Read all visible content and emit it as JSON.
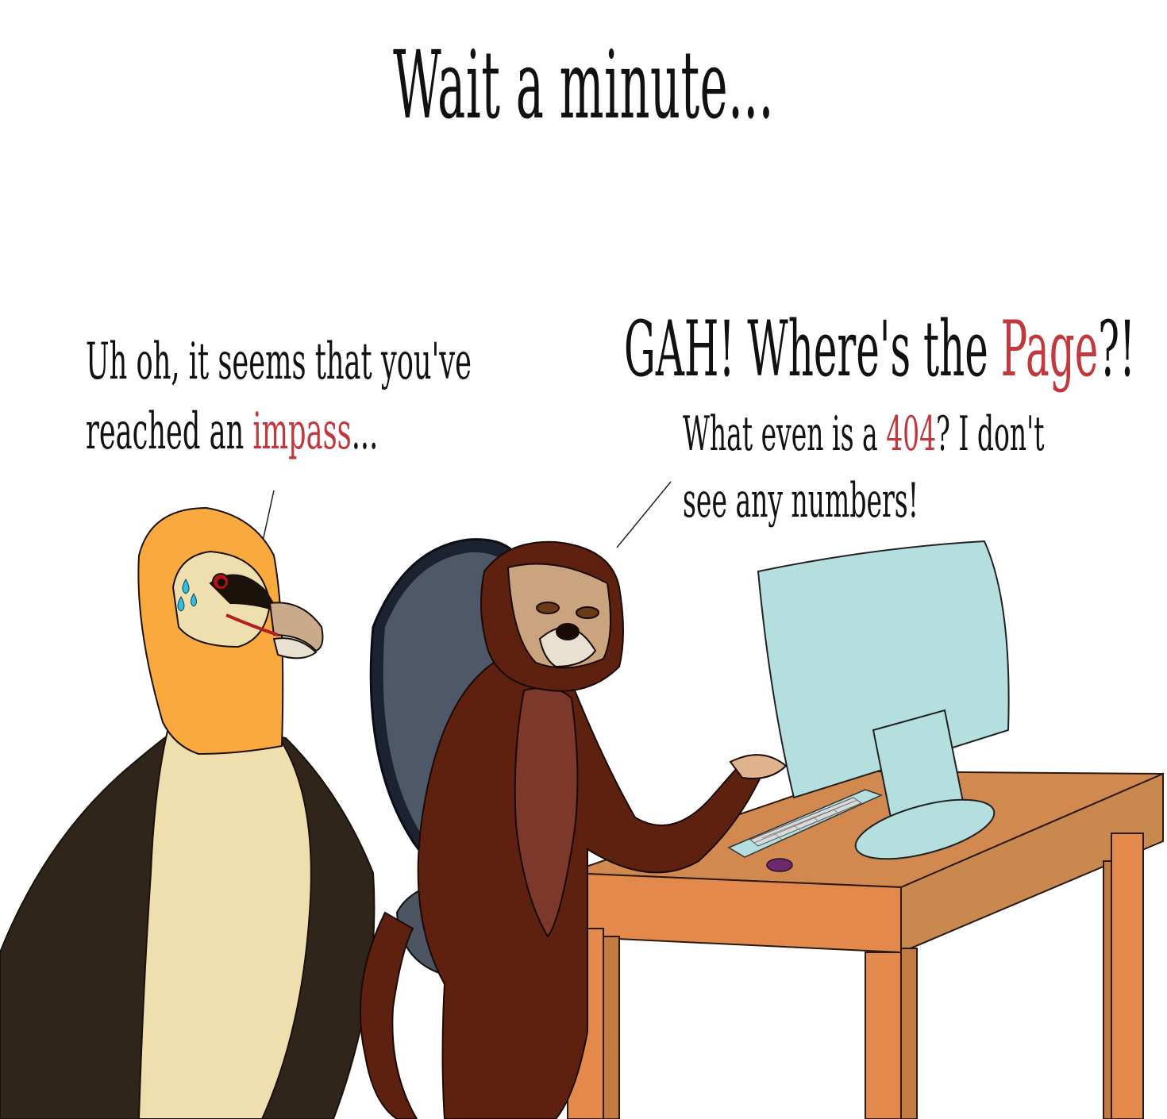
{
  "comic": {
    "title": "Wait a minute...",
    "vulture_speech": {
      "line1": "Uh oh, it seems that you've",
      "line2_before": "reached an ",
      "line2_emphasis": "impass",
      "line2_after": "..."
    },
    "monkey_exclaim": {
      "before": "GAH! Where's the ",
      "emphasis": "Page",
      "after": "?!"
    },
    "monkey_speech": {
      "line1_before": "What even is a ",
      "line1_emphasis": "404",
      "line1_after": "? I don't",
      "line2": "see any numbers!"
    }
  },
  "colors": {
    "accent_red": "#c0393f",
    "monkey_fur": "#5e2110",
    "desk": "#e4894c",
    "monitor": "#b5dfdf",
    "vulture_mane": "#f9a93e"
  }
}
